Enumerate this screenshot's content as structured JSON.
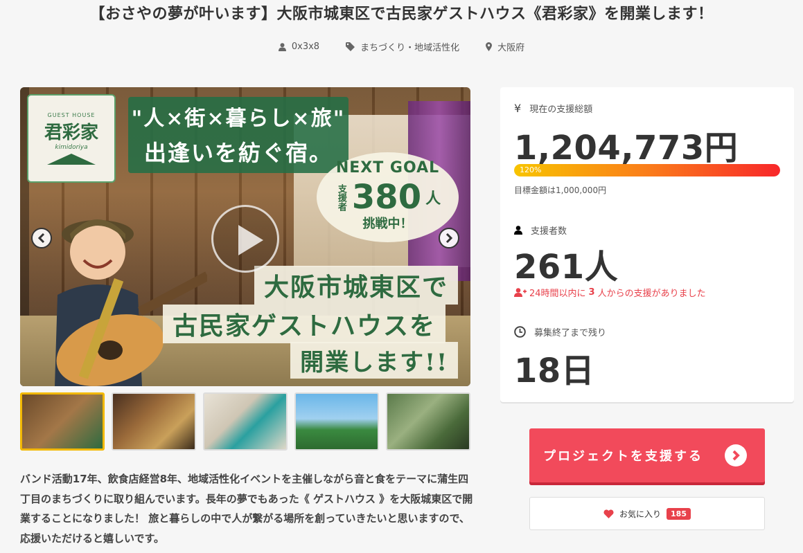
{
  "project": {
    "title": "【おさやの夢が叶います】大阪市城東区で古民家ゲストハウス《君彩家》を開業します！",
    "meta": {
      "owner": "0x3x8",
      "category": "まちづくり・地域活性化",
      "location": "大阪府"
    },
    "description": "バンド活動17年、飲食店経営8年、地域活性化イベントを主催しながら音と食をテーマに蒲生四丁目のまちづくりに取り組んでいます。長年の夢でもあった《 ゲストハウス 》を大阪城東区で開業することになりました！ 旅と暮らしの中で人が繋がる場所を創っていきたいと思いますので、応援いただけると嬉しいです。"
  },
  "hero": {
    "logo_small": "GUEST HOUSE",
    "logo_main": "君彩家",
    "logo_sub": "kimidoriya",
    "slogan_line1": "\"人×街×暮らし×旅\"",
    "slogan_line2": "出逢いを紡ぐ宿。",
    "goal_title": "NEXT GOAL",
    "goal_label": "支援者",
    "goal_number": "380",
    "goal_unit": "人",
    "goal_challenge": "挑戦中！",
    "text_line1": "大阪市城東区で",
    "text_line2": "古民家ゲストハウスを",
    "text_line3": "開業します!!"
  },
  "thumbnails": [
    {
      "name": "thumb-1",
      "active": true
    },
    {
      "name": "thumb-2",
      "active": false
    },
    {
      "name": "thumb-3",
      "active": false
    },
    {
      "name": "thumb-4",
      "active": false
    },
    {
      "name": "thumb-5",
      "active": false
    }
  ],
  "stats": {
    "amount_label": "現在の支援総額",
    "amount": "1,204,773円",
    "progress_percent": 120,
    "progress_label": "120%",
    "goal_note": "目標金額は1,000,000円",
    "backers_label": "支援者数",
    "backers": "261人",
    "recent_pre": "24時間以内に",
    "recent_count": "3",
    "recent_post": "人からの支援がありました",
    "remaining_label": "募集終了まで残り",
    "remaining": "18日"
  },
  "actions": {
    "support_label": "プロジェクトを支援する",
    "favorite_label": "お気に入り",
    "favorite_count": "185"
  },
  "colors": {
    "accent": "#f24a5b",
    "alert": "#e8414b",
    "thumb_active": "#f2b800"
  }
}
